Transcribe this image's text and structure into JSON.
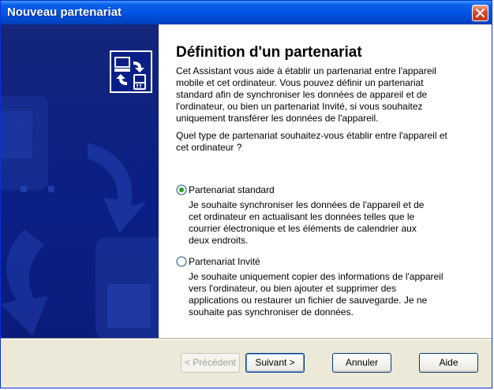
{
  "window": {
    "title": "Nouveau partenariat"
  },
  "wizard": {
    "heading": "Définition d'un partenariat",
    "intro": "Cet Assistant vous aide à établir un partenariat entre l'appareil\nmobile et cet ordinateur. Vous pouvez définir un partenariat\nstandard afin de synchroniser les données de appareil et de\nl'ordinateur, ou bien un partenariat Invité, si vous souhaitez\nuniquement transférer les données de l'appareil.",
    "question": "Quel type de partenariat souhaitez-vous établir entre l'appareil et\ncet ordinateur ?",
    "options": [
      {
        "label": "Partenariat standard",
        "selected": true,
        "description": "Je souhaite synchroniser les données de l'appareil et de\ncet ordinateur en actualisant les données telles que le\ncourrier électronique et les éléments de calendrier aux\ndeux endroits."
      },
      {
        "label": "Partenariat Invité",
        "selected": false,
        "description": "Je souhaite uniquement copier des informations de l'appareil\nvers l'ordinateur, ou bien ajouter et supprimer des\napplications ou restaurer un fichier de sauvegarde. Je ne\nsouhaite pas synchroniser de données."
      }
    ]
  },
  "buttons": {
    "previous": "< Précédent",
    "next": "Suivant >",
    "cancel": "Annuler",
    "help": "Aide"
  },
  "icons": {
    "close": "close-icon",
    "wizard": "sync-devices-icon",
    "radio_selected": "radio-selected-icon",
    "radio_unselected": "radio-unselected-icon"
  },
  "colors": {
    "titlebar": "#0054e3",
    "left_panel": "#0a1f86",
    "dialog_bg": "#ece9d8",
    "close_button": "#d8472a"
  }
}
